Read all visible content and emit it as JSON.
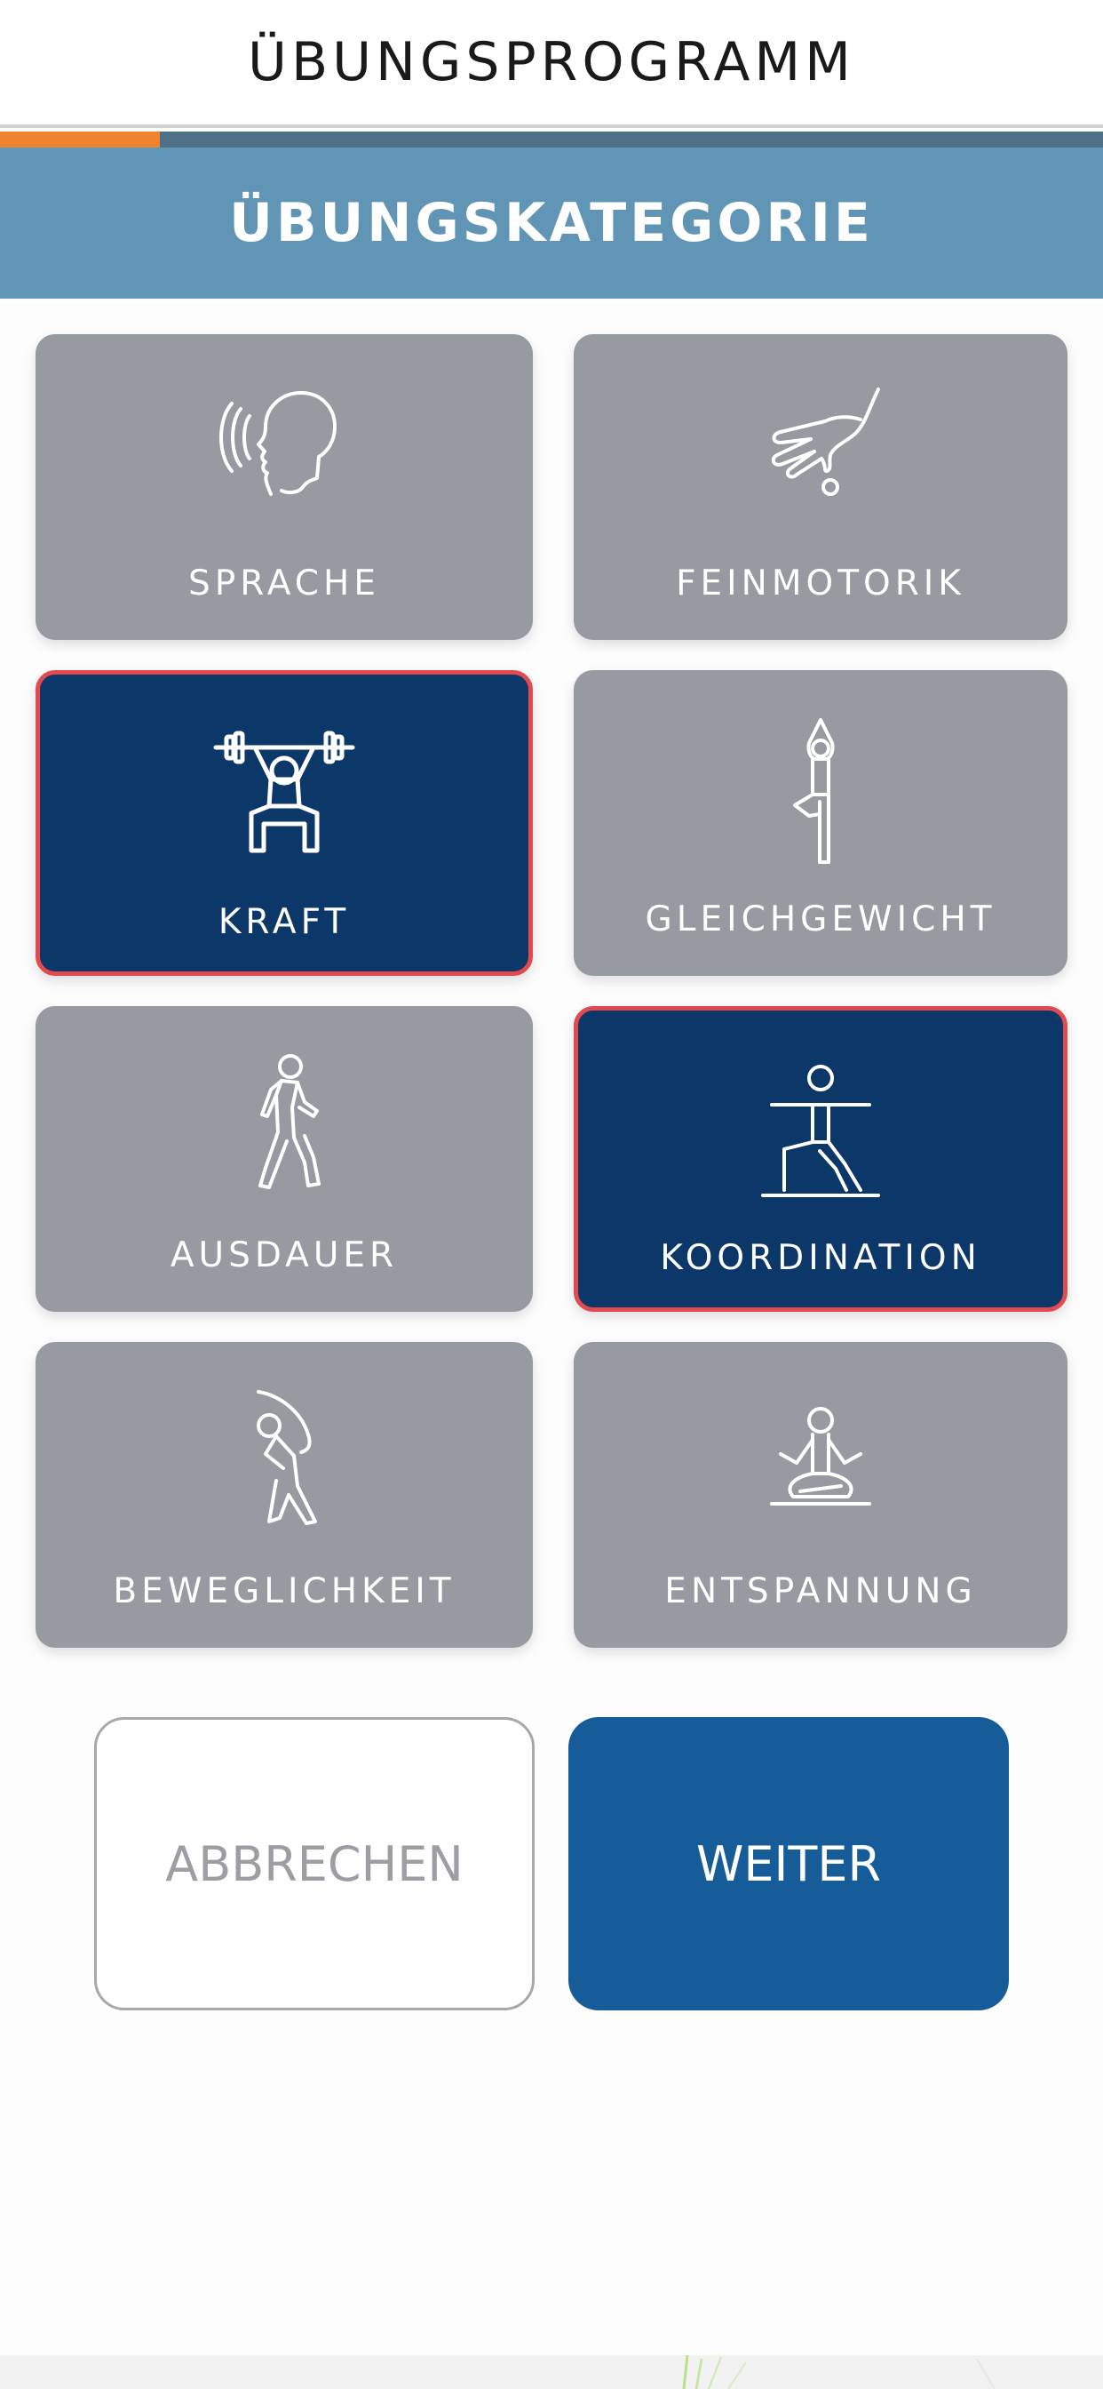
{
  "header": {
    "title": "ÜBUNGSPROGRAMM"
  },
  "progress": {
    "fraction": 0.145
  },
  "section": {
    "title": "ÜBUNGSKATEGORIE"
  },
  "categories": [
    {
      "label": "SPRACHE",
      "icon": "speaking-head-icon",
      "selected": false
    },
    {
      "label": "FEINMOTORIK",
      "icon": "hand-fine-motor-icon",
      "selected": false
    },
    {
      "label": "KRAFT",
      "icon": "weightlifter-icon",
      "selected": true
    },
    {
      "label": "GLEICHGEWICHT",
      "icon": "tree-pose-balance-icon",
      "selected": false
    },
    {
      "label": "AUSDAUER",
      "icon": "walking-person-icon",
      "selected": false
    },
    {
      "label": "KOORDINATION",
      "icon": "warrior-pose-icon",
      "selected": true
    },
    {
      "label": "BEWEGLICHKEIT",
      "icon": "side-stretch-icon",
      "selected": false
    },
    {
      "label": "ENTSPANNUNG",
      "icon": "meditation-icon",
      "selected": false
    }
  ],
  "buttons": {
    "cancel": "ABBRECHEN",
    "next": "WEITER"
  },
  "colors": {
    "tile_default": "#979aa1",
    "tile_selected": "#0c3769",
    "selected_border": "#e24a50",
    "progress_fill": "#f0842e",
    "section_band": "#6195b5",
    "primary_button": "#165c99"
  }
}
